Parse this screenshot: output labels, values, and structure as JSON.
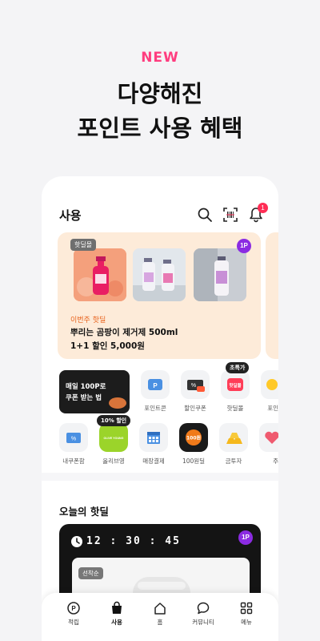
{
  "promo": {
    "new_label": "NEW",
    "title_line1": "다양해진",
    "title_line2": "포인트 사용 혜택"
  },
  "header": {
    "title": "사용",
    "notification_count": "1"
  },
  "deal_card": {
    "tag": "핫딜몰",
    "point_badge": "1P",
    "week_label": "이번주 핫딜",
    "product_name": "뿌리는 곰팡이 제거제 500ml",
    "price_line": "1+1 할인 5,000원"
  },
  "banner": {
    "line1": "매일 100P로",
    "line2": "쿠폰 받는 법"
  },
  "quick_menu_row1": [
    {
      "label": "포인트콘",
      "icon": "point-card-icon"
    },
    {
      "label": "할인쿠폰",
      "icon": "coupon-icon"
    },
    {
      "label": "핫딜몰",
      "icon": "hotdeal-icon",
      "badge": "초특가"
    },
    {
      "label": "포인",
      "icon": "yellow-icon"
    }
  ],
  "quick_menu_row2": [
    {
      "label": "내쿠폰함",
      "icon": "my-coupon-icon"
    },
    {
      "label": "올리브영",
      "icon": "oliveyoung-icon",
      "badge": "10% 할인",
      "logo_text": "OLIVE YOUNG"
    },
    {
      "label": "매장결제",
      "icon": "store-pay-icon"
    },
    {
      "label": "100원딜",
      "icon": "100won-icon",
      "logo_text": "100원"
    },
    {
      "label": "금투자",
      "icon": "gold-bar-icon"
    },
    {
      "label": "주",
      "icon": "heart-icon"
    }
  ],
  "hot_today": {
    "title": "오늘의 핫딜",
    "timer": "12 : 30 : 45",
    "point_badge": "1P",
    "first_come_tag": "선착순"
  },
  "bottom_nav": [
    {
      "label": "적립",
      "icon": "point-earn-icon",
      "active": false
    },
    {
      "label": "사용",
      "icon": "shopping-bag-icon",
      "active": true
    },
    {
      "label": "홈",
      "icon": "home-icon",
      "active": false
    },
    {
      "label": "커뮤니티",
      "icon": "chat-icon",
      "active": false
    },
    {
      "label": "메뉴",
      "icon": "grid-menu-icon",
      "active": false
    }
  ],
  "colors": {
    "accent_pink": "#ff3d7f",
    "deal_orange": "#e8621c",
    "point_purple": "#8b2be2",
    "oliveyoung_green": "#9bd42a",
    "notification_red": "#ff2d55"
  }
}
